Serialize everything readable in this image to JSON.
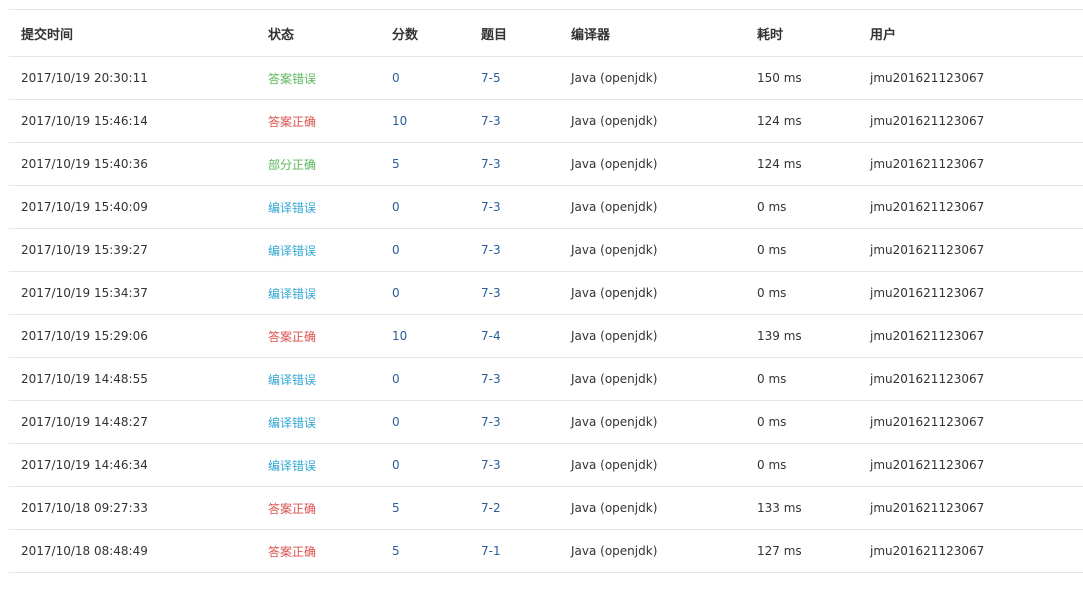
{
  "table": {
    "headers": {
      "time": "提交时间",
      "status": "状态",
      "score": "分数",
      "problem": "题目",
      "compiler": "编译器",
      "cost": "耗时",
      "user": "用户"
    },
    "status_colors": {
      "wrong": "#5cb85c",
      "ok": "#d9534f",
      "partial": "#5cb85c",
      "compile": "#31a6d3"
    },
    "rows": [
      {
        "time": "2017/10/19 20:30:11",
        "status": "答案错误",
        "status_type": "wrong",
        "score": "0",
        "problem": "7-5",
        "compiler": "Java (openjdk)",
        "cost": "150 ms",
        "user": "jmu201621123067"
      },
      {
        "time": "2017/10/19 15:46:14",
        "status": "答案正确",
        "status_type": "ok",
        "score": "10",
        "problem": "7-3",
        "compiler": "Java (openjdk)",
        "cost": "124 ms",
        "user": "jmu201621123067"
      },
      {
        "time": "2017/10/19 15:40:36",
        "status": "部分正确",
        "status_type": "partial",
        "score": "5",
        "problem": "7-3",
        "compiler": "Java (openjdk)",
        "cost": "124 ms",
        "user": "jmu201621123067"
      },
      {
        "time": "2017/10/19 15:40:09",
        "status": "编译错误",
        "status_type": "compile",
        "score": "0",
        "problem": "7-3",
        "compiler": "Java (openjdk)",
        "cost": "0 ms",
        "user": "jmu201621123067"
      },
      {
        "time": "2017/10/19 15:39:27",
        "status": "编译错误",
        "status_type": "compile",
        "score": "0",
        "problem": "7-3",
        "compiler": "Java (openjdk)",
        "cost": "0 ms",
        "user": "jmu201621123067"
      },
      {
        "time": "2017/10/19 15:34:37",
        "status": "编译错误",
        "status_type": "compile",
        "score": "0",
        "problem": "7-3",
        "compiler": "Java (openjdk)",
        "cost": "0 ms",
        "user": "jmu201621123067"
      },
      {
        "time": "2017/10/19 15:29:06",
        "status": "答案正确",
        "status_type": "ok",
        "score": "10",
        "problem": "7-4",
        "compiler": "Java (openjdk)",
        "cost": "139 ms",
        "user": "jmu201621123067"
      },
      {
        "time": "2017/10/19 14:48:55",
        "status": "编译错误",
        "status_type": "compile",
        "score": "0",
        "problem": "7-3",
        "compiler": "Java (openjdk)",
        "cost": "0 ms",
        "user": "jmu201621123067"
      },
      {
        "time": "2017/10/19 14:48:27",
        "status": "编译错误",
        "status_type": "compile",
        "score": "0",
        "problem": "7-3",
        "compiler": "Java (openjdk)",
        "cost": "0 ms",
        "user": "jmu201621123067"
      },
      {
        "time": "2017/10/19 14:46:34",
        "status": "编译错误",
        "status_type": "compile",
        "score": "0",
        "problem": "7-3",
        "compiler": "Java (openjdk)",
        "cost": "0 ms",
        "user": "jmu201621123067"
      },
      {
        "time": "2017/10/18 09:27:33",
        "status": "答案正确",
        "status_type": "ok",
        "score": "5",
        "problem": "7-2",
        "compiler": "Java (openjdk)",
        "cost": "133 ms",
        "user": "jmu201621123067"
      },
      {
        "time": "2017/10/18 08:48:49",
        "status": "答案正确",
        "status_type": "ok",
        "score": "5",
        "problem": "7-1",
        "compiler": "Java (openjdk)",
        "cost": "127 ms",
        "user": "jmu201621123067"
      }
    ]
  }
}
